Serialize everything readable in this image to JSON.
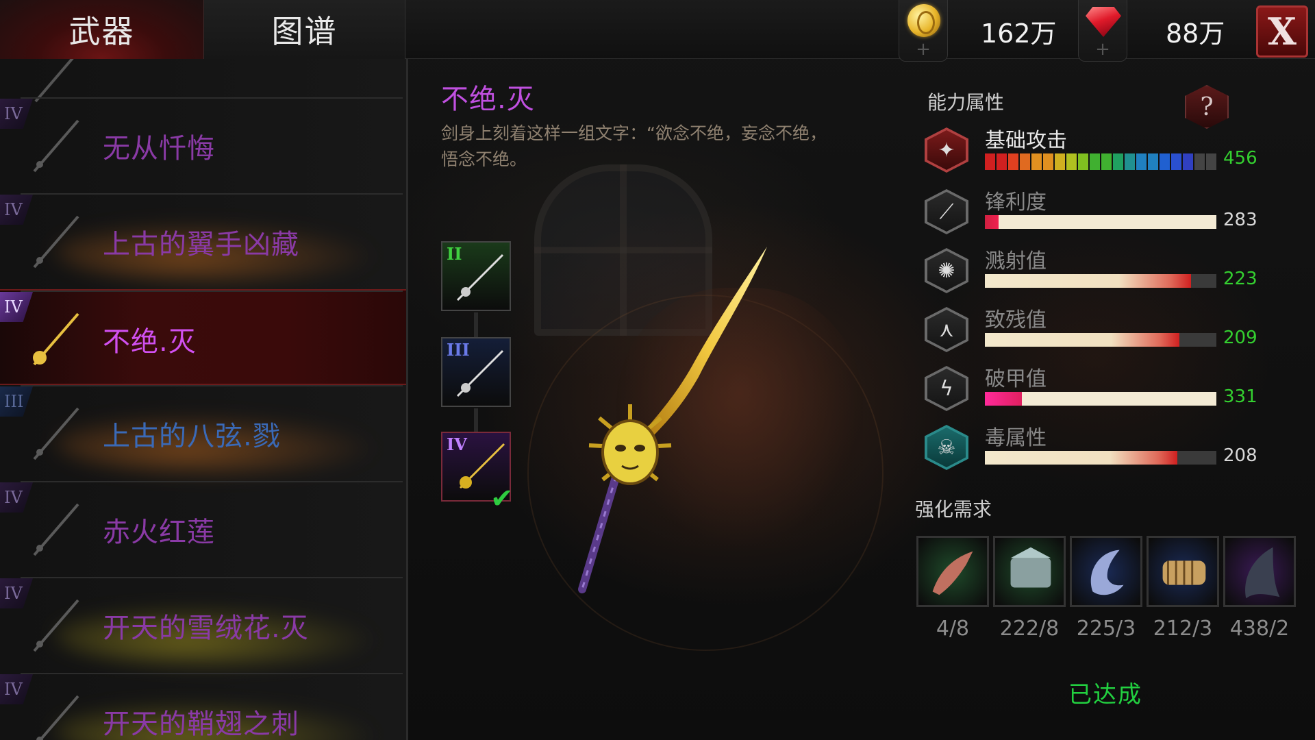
{
  "tabs": {
    "weapon": "武器",
    "atlas": "图谱"
  },
  "currency": {
    "gold": {
      "icon": "gold-coin-icon",
      "value": "162万",
      "add": "+"
    },
    "gem": {
      "icon": "red-gem-icon",
      "value": "88万",
      "add": "+"
    }
  },
  "close_label": "X",
  "weapon_list": [
    {
      "tier": "IV",
      "name": "无从忏悔",
      "name_color": "#8a3aa6",
      "selected": false,
      "smoke": ""
    },
    {
      "tier": "IV",
      "name": "上古的翼手凶藏",
      "name_color": "#8a3aa6",
      "selected": false,
      "smoke": "#c06a20"
    },
    {
      "tier": "IV",
      "name": "不绝.灭",
      "name_color": "#d050f0",
      "selected": true,
      "smoke": ""
    },
    {
      "tier": "III",
      "name": "上古的八弦.戮",
      "name_color": "#3a6ab8",
      "selected": false,
      "smoke": "#c06a20"
    },
    {
      "tier": "IV",
      "name": "赤火红莲",
      "name_color": "#8a3aa6",
      "selected": false,
      "smoke": ""
    },
    {
      "tier": "IV",
      "name": "开天的雪绒花.灭",
      "name_color": "#8a3aa6",
      "selected": false,
      "smoke": "#b0a020"
    },
    {
      "tier": "IV",
      "name": "开天的鞘翅之刺",
      "name_color": "#8a3aa6",
      "selected": false,
      "smoke": "#b0a020"
    }
  ],
  "detail": {
    "name": "不绝.灭",
    "description": "剑身上刻着这样一组文字：“欲念不绝，妄念不绝，悟念不绝。"
  },
  "tier_cards": [
    {
      "roman": "II",
      "color": "#1a3a1a",
      "text_color": "#40d040"
    },
    {
      "roman": "III",
      "color": "#141e38",
      "text_color": "#6a7ae8"
    },
    {
      "roman": "IV",
      "color": "#2a1240",
      "text_color": "#c080ff",
      "current": true,
      "check": "✔"
    }
  ],
  "stats": {
    "title": "能力属性",
    "help": "?",
    "items": [
      {
        "icon": "attack-icon",
        "label": "基础攻击",
        "value": "456",
        "fill": 0.9,
        "value_color": "green",
        "rainbow": true
      },
      {
        "icon": "sharpness-icon",
        "label": "锋利度",
        "value": "283",
        "fill": 0.06,
        "value_color": "white"
      },
      {
        "icon": "splash-icon",
        "label": "溅射值",
        "value": "223",
        "fill": 0.89,
        "value_color": "green"
      },
      {
        "icon": "cripple-icon",
        "label": "致残值",
        "value": "209",
        "fill": 0.84,
        "value_color": "green"
      },
      {
        "icon": "armor-break-icon",
        "label": "破甲值",
        "value": "331",
        "fill": 0.16,
        "value_color": "green"
      },
      {
        "icon": "poison-skull-icon",
        "label": "毒属性",
        "value": "208",
        "fill": 0.83,
        "value_color": "white"
      }
    ]
  },
  "upgrade": {
    "title": "强化需求",
    "materials": [
      {
        "icon": "claw-material-icon",
        "count": "4/8",
        "bg": "#1f4a2a"
      },
      {
        "icon": "scale-chunk-material-icon",
        "count": "222/8",
        "bg": "#1f4a2a"
      },
      {
        "icon": "hook-claw-material-icon",
        "count": "225/3",
        "bg": "#1a2a55"
      },
      {
        "icon": "spine-material-icon",
        "count": "212/3",
        "bg": "#1a2a55"
      },
      {
        "icon": "fin-material-icon",
        "count": "438/2",
        "bg": "#3a1a55"
      }
    ],
    "status": "已达成"
  }
}
